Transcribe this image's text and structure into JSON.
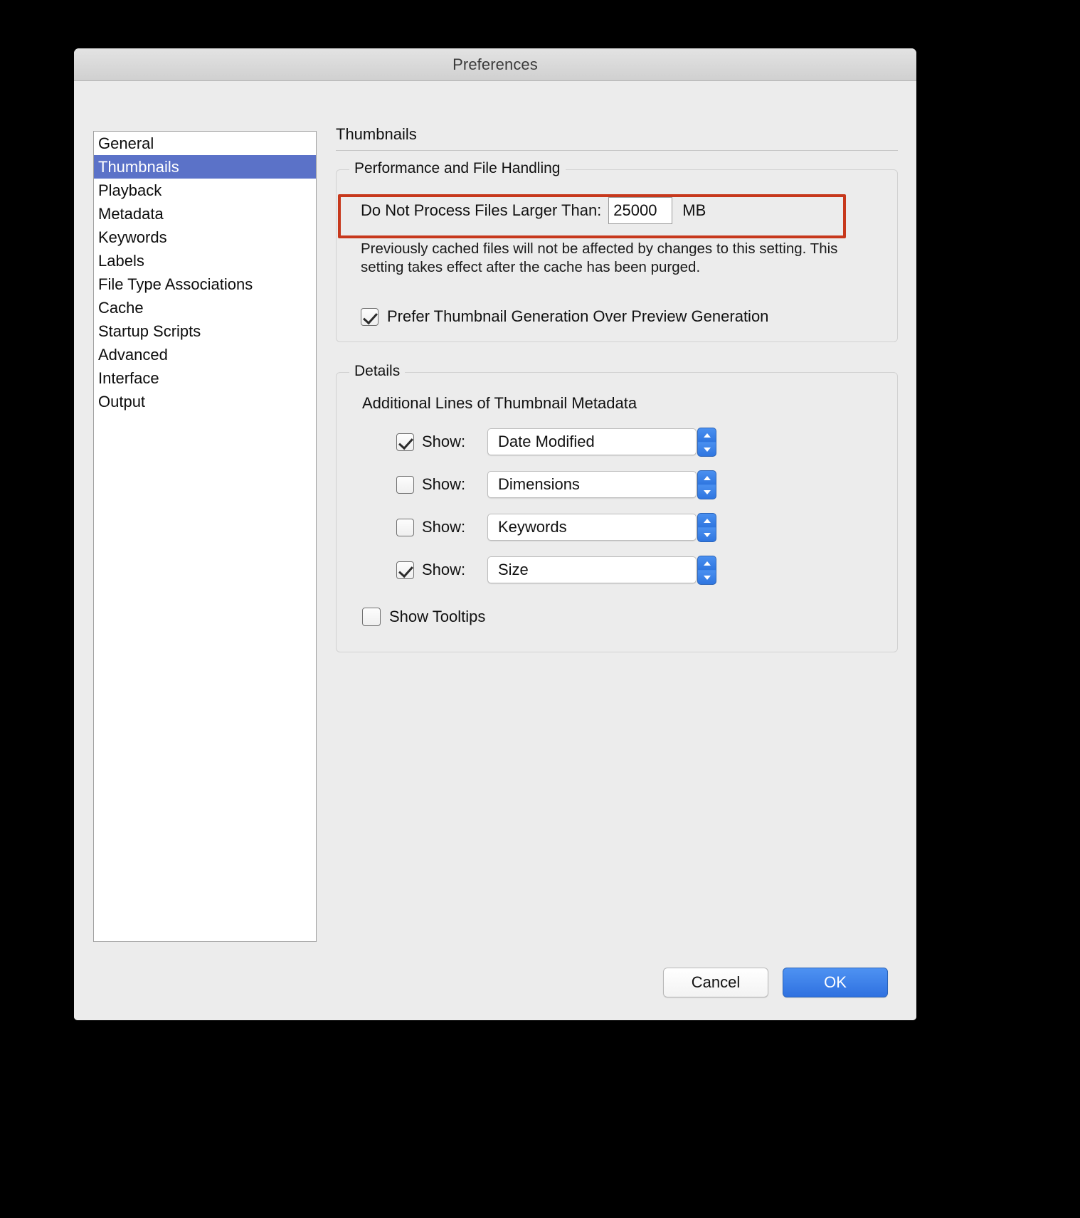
{
  "window": {
    "title": "Preferences"
  },
  "sidebar": {
    "items": [
      {
        "label": "General",
        "selected": false
      },
      {
        "label": "Thumbnails",
        "selected": true
      },
      {
        "label": "Playback",
        "selected": false
      },
      {
        "label": "Metadata",
        "selected": false
      },
      {
        "label": "Keywords",
        "selected": false
      },
      {
        "label": "Labels",
        "selected": false
      },
      {
        "label": "File Type Associations",
        "selected": false
      },
      {
        "label": "Cache",
        "selected": false
      },
      {
        "label": "Startup Scripts",
        "selected": false
      },
      {
        "label": "Advanced",
        "selected": false
      },
      {
        "label": "Interface",
        "selected": false
      },
      {
        "label": "Output",
        "selected": false
      }
    ],
    "selected_color": "#5b72c8"
  },
  "pane": {
    "title": "Thumbnails",
    "performance": {
      "legend": "Performance and File Handling",
      "limit_label": "Do Not Process Files Larger Than:",
      "limit_value": "25000",
      "limit_unit": "MB",
      "highlight_color": "#c7381c",
      "help_text": "Previously cached files will not be affected by changes to this setting. This setting takes effect after the cache has been purged.",
      "prefer_label": "Prefer Thumbnail Generation Over Preview Generation",
      "prefer_checked": true
    },
    "details": {
      "legend": "Details",
      "heading": "Additional Lines of Thumbnail Metadata",
      "rows": [
        {
          "show_label": "Show:",
          "checked": true,
          "value": "Date Modified"
        },
        {
          "show_label": "Show:",
          "checked": false,
          "value": "Dimensions"
        },
        {
          "show_label": "Show:",
          "checked": false,
          "value": "Keywords"
        },
        {
          "show_label": "Show:",
          "checked": true,
          "value": "Size"
        }
      ],
      "tooltips_label": "Show Tooltips",
      "tooltips_checked": false
    }
  },
  "footer": {
    "cancel_label": "Cancel",
    "ok_label": "OK",
    "ok_color": "#2f71e0"
  }
}
